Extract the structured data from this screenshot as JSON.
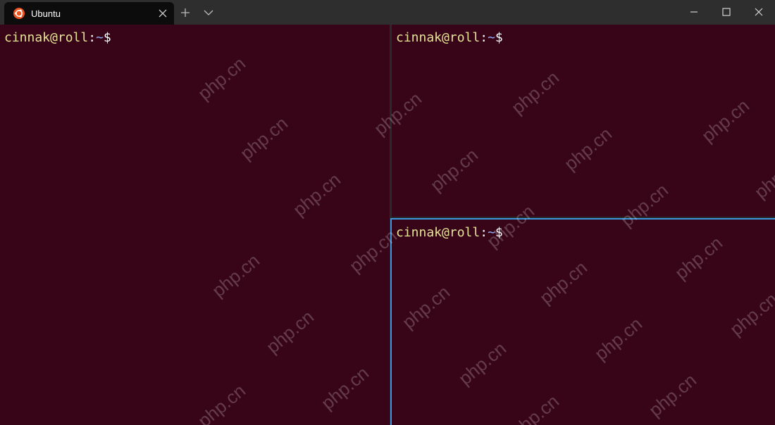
{
  "window": {
    "app": "Windows Terminal",
    "tab": {
      "title": "Ubuntu",
      "icon": "ubuntu-icon",
      "close_icon": "close-icon"
    },
    "toolbar": {
      "new_tab_icon": "plus-icon",
      "dropdown_icon": "chevron-down-icon"
    },
    "controls": {
      "minimize_icon": "minimize-icon",
      "maximize_icon": "maximize-icon",
      "close_icon": "close-icon"
    }
  },
  "panes": [
    {
      "user": "cinnak@roll",
      "colon": ":",
      "path": "~",
      "symbol": "$",
      "focused": false
    },
    {
      "user": "cinnak@roll",
      "colon": ":",
      "path": "~",
      "symbol": "$",
      "focused": false
    },
    {
      "user": "cinnak@roll",
      "colon": ":",
      "path": "~",
      "symbol": "$",
      "focused": true
    }
  ],
  "watermark": {
    "text": "php.cn"
  },
  "colors": {
    "background": "#380417",
    "titlebar": "#2e2e2e",
    "tab": "#0c0c0c",
    "focus_border": "#3a96dd",
    "prompt_user": "#e5e596",
    "prompt_path": "#8fb3ff",
    "ubuntu_orange": "#e95420"
  }
}
